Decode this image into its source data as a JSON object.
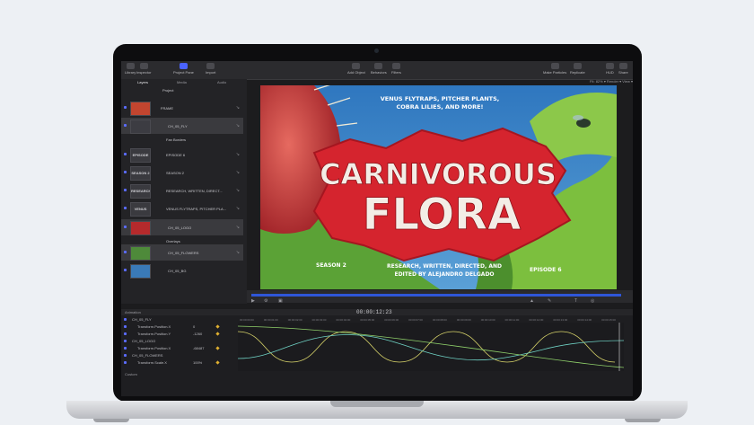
{
  "toolbar": {
    "left": [
      {
        "label": "Library",
        "icon": "library-icon"
      },
      {
        "label": "Inspector",
        "icon": "inspector-icon"
      },
      {
        "label": "Project Pane",
        "icon": "project-pane-icon",
        "active": true
      },
      {
        "label": "Import",
        "icon": "import-icon"
      }
    ],
    "center": [
      {
        "label": "Add Object",
        "icon": "add-object-icon"
      },
      {
        "label": "Behaviors",
        "icon": "behaviors-icon"
      },
      {
        "label": "Filters",
        "icon": "filters-icon"
      }
    ],
    "right": [
      {
        "label": "Make Particles",
        "icon": "particles-icon"
      },
      {
        "label": "Replicate",
        "icon": "replicate-icon"
      },
      {
        "label": "HUD",
        "icon": "hud-icon"
      },
      {
        "label": "Share",
        "icon": "share-icon"
      }
    ]
  },
  "panel_tabs": [
    "Layers",
    "Media",
    "Audio"
  ],
  "viewer_header": "Fit: 82% ▾  Render ▾  View ▾",
  "layers": [
    {
      "label": "Project",
      "thumb": "",
      "type": "header"
    },
    {
      "label": "FRAME",
      "thumb": "",
      "highlight": false
    },
    {
      "label": "CH_05_FLY",
      "thumb": "",
      "highlight": true
    },
    {
      "label": "Fan Borders",
      "thumb": "",
      "small": true
    },
    {
      "label": "EPISODE 6",
      "thumb": "EPISODE 6",
      "highlight": false
    },
    {
      "label": "SEASON 2",
      "thumb": "SEASON 2",
      "highlight": false
    },
    {
      "label": "RESEARCH, WRITTEN, DIRECT...",
      "thumb": "RESEARCH",
      "highlight": false
    },
    {
      "label": "VENUS FLYTRAPS, PITCHER PLA...",
      "thumb": "VENUS FLY",
      "highlight": false
    },
    {
      "label": "CH_05_LOGO",
      "thumb": "",
      "highlight": true
    },
    {
      "label": "Overlays",
      "thumb": "",
      "small": true
    },
    {
      "label": "CH_05_FLOWERS",
      "thumb": "",
      "highlight": true
    },
    {
      "label": "CH_05_BG",
      "thumb": "",
      "highlight": false
    }
  ],
  "poster": {
    "tagline": [
      "VENUS FLYTRAPS, PITCHER PLANTS,",
      "COBRA LILIES, AND MORE!"
    ],
    "title_line1": "CARNIVOROUS",
    "title_line2": "FLORA",
    "season": "SEASON 2",
    "credits": [
      "RESEARCH, WRITTEN, DIRECTED, AND",
      "EDITED BY ALEJANDRO DELGADO"
    ],
    "episode": "EPISODE 6",
    "colors": {
      "sky": "#3a86c8",
      "leaf": "#6fb33a",
      "logo": "#d8262f",
      "trap": "#c73b39"
    }
  },
  "playback": {
    "timecode": "00:00:12:23",
    "progress": 1.0
  },
  "keyframes": {
    "header_label": "Animation",
    "rows": [
      {
        "name": "CH_05_FLY",
        "value": "",
        "indent": 0
      },
      {
        "name": "Transform.Position.X",
        "value": "0",
        "indent": 1
      },
      {
        "name": "Transform.Position.Y",
        "value": "-1260",
        "indent": 1
      },
      {
        "name": "CH_05_LOGO",
        "value": "",
        "indent": 0
      },
      {
        "name": "Transform.Position.X",
        "value": "-68487",
        "indent": 1
      },
      {
        "name": "CH_05_FLOWERS",
        "value": "",
        "indent": 0
      },
      {
        "name": "Transform.Scale.X",
        "value": "100%",
        "indent": 1
      }
    ],
    "footer_label": "Custom",
    "ruler_ticks": [
      "00:00:00:00",
      "00:00:01:00",
      "00:00:02:00",
      "00:00:03:00",
      "00:00:04:00",
      "00:00:05:00",
      "00:00:06:00",
      "00:00:07:00",
      "00:00:08:00",
      "00:00:09:00",
      "00:00:10:00",
      "00:00:11:00",
      "00:00:12:00",
      "00:00:13:00",
      "00:00:14:00",
      "00:00:15:00"
    ]
  }
}
